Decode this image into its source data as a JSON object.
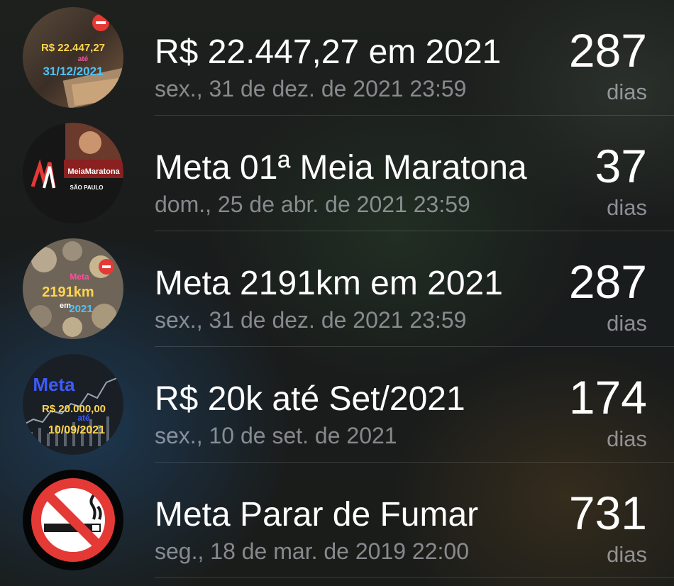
{
  "events": [
    {
      "title": "R$ 22.447,27 em 2021",
      "date": "sex., 31 de dez. de 2021 23:59",
      "count": "287",
      "unit": "dias",
      "thumb": {
        "icon": "money-stack-goal-icon",
        "line1": "R$ 22.447,27",
        "line2": "até",
        "line3": "31/12/2021"
      }
    },
    {
      "title": "Meta 01ª Meia Maratona",
      "date": "dom., 25 de abr. de 2021 23:59",
      "count": "37",
      "unit": "dias",
      "thumb": {
        "icon": "half-marathon-logo-icon",
        "line1": "MeiaMaratona",
        "line2": "SÃO PAULO"
      }
    },
    {
      "title": "Meta 2191km em 2021",
      "date": "sex., 31 de dez. de 2021 23:59",
      "count": "287",
      "unit": "dias",
      "thumb": {
        "icon": "coins-goal-icon",
        "line1": "Meta",
        "line2": "2191km",
        "line3": "em",
        "line4": "2021"
      }
    },
    {
      "title": "R$ 20k até Set/2021",
      "date": "sex., 10 de set. de 2021",
      "count": "174",
      "unit": "dias",
      "thumb": {
        "icon": "stock-chart-goal-icon",
        "line1": "Meta",
        "line2": "R$ 20.000,00",
        "line3": "até",
        "line4": "10/09/2021"
      }
    },
    {
      "title": "Meta Parar de Fumar",
      "date": "seg., 18 de mar. de 2019 22:00",
      "count": "731",
      "unit": "dias",
      "thumb": {
        "icon": "no-smoking-icon"
      }
    }
  ]
}
